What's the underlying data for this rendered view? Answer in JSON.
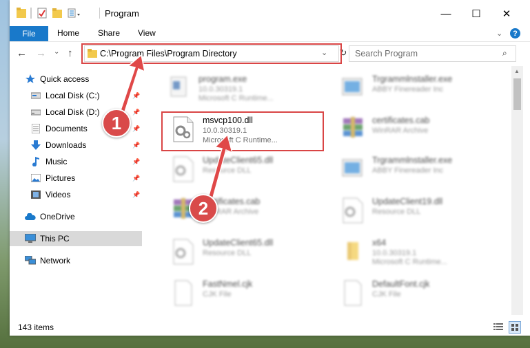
{
  "window": {
    "title": "Program",
    "controls": {
      "minimize": "—",
      "maximize": "☐",
      "close": "✕"
    }
  },
  "ribbon": {
    "file": "File",
    "tabs": [
      "Home",
      "Share",
      "View"
    ]
  },
  "address": {
    "path": "C:\\Program Files\\Program Directory"
  },
  "search": {
    "placeholder": "Search Program"
  },
  "sidebar": {
    "items": [
      {
        "label": "Quick access",
        "icon": "star-icon",
        "pinned": false
      },
      {
        "label": "Local Disk (C:)",
        "icon": "drive-icon",
        "pinned": true
      },
      {
        "label": "Local Disk (D:)",
        "icon": "drive-icon",
        "pinned": true
      },
      {
        "label": "Documents",
        "icon": "documents-icon",
        "pinned": true
      },
      {
        "label": "Downloads",
        "icon": "downloads-icon",
        "pinned": true
      },
      {
        "label": "Music",
        "icon": "music-icon",
        "pinned": true
      },
      {
        "label": "Pictures",
        "icon": "pictures-icon",
        "pinned": true
      },
      {
        "label": "Videos",
        "icon": "videos-icon",
        "pinned": true
      },
      {
        "label": "OneDrive",
        "icon": "cloud-icon",
        "pinned": false
      },
      {
        "label": "This PC",
        "icon": "computer-icon",
        "pinned": false,
        "selected": true
      },
      {
        "label": "Network",
        "icon": "network-icon",
        "pinned": false
      }
    ]
  },
  "files": [
    {
      "name": "program.exe",
      "line1": "10.0.30319.1",
      "line2": "Microsoft C Runtime...",
      "icon": "exe-icon"
    },
    {
      "name": "Trgrammlnstaller.exe",
      "line1": "ABBY Finereader Inc",
      "line2": "",
      "icon": "installer-icon"
    },
    {
      "name": "msvcp100.dll",
      "line1": "10.0.30319.1",
      "line2": "Microsoft C Runtime...",
      "icon": "dll-icon"
    },
    {
      "name": "certificates.cab",
      "line1": "WinRAR Archive",
      "line2": "",
      "icon": "archive-icon"
    },
    {
      "name": "UpdateClient65.dll",
      "line1": "Resource DLL",
      "line2": "",
      "icon": "dll-icon"
    },
    {
      "name": "Trgrammlnstaller.exe",
      "line1": "ABBY Finereader Inc",
      "line2": "",
      "icon": "installer-icon"
    },
    {
      "name": "certificates.cab",
      "line1": "WinRAR Archive",
      "line2": "",
      "icon": "archive-icon"
    },
    {
      "name": "UpdateClient19.dll",
      "line1": "Resource DLL",
      "line2": "",
      "icon": "dll-icon"
    },
    {
      "name": "UpdateClient65.dll",
      "line1": "Resource DLL",
      "line2": "",
      "icon": "dll-icon"
    },
    {
      "name": "x64",
      "line1": "10.0.30319.1",
      "line2": "Microsoft C Runtime...",
      "icon": "folder-icon"
    },
    {
      "name": "FastNmel.cjk",
      "line1": "CJK File",
      "line2": "",
      "icon": "file-icon"
    },
    {
      "name": "DefaultFont.cjk",
      "line1": "CJK File",
      "line2": "",
      "icon": "file-icon"
    }
  ],
  "status": {
    "count": "143 items"
  },
  "annotations": {
    "step1": "1",
    "step2": "2"
  },
  "colors": {
    "accent": "#1979ca",
    "highlight": "#d94545",
    "badge": "#d94a4a",
    "selection": "#d9d9d9"
  }
}
